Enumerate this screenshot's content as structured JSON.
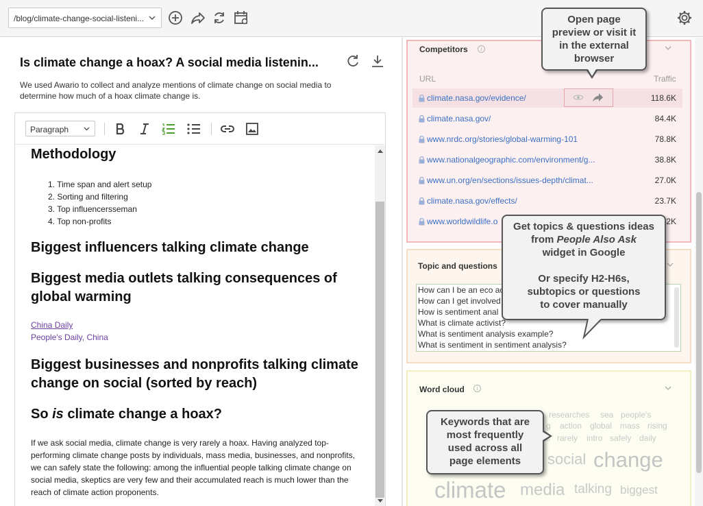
{
  "topbar": {
    "url_value": "/blog/climate-change-social-listeni...",
    "icons": [
      "add-icon",
      "share-icon",
      "refresh-icon",
      "calendar-icon",
      "gear-icon"
    ]
  },
  "page": {
    "title": "Is climate change a hoax? A social media listenin...",
    "description": "We used Awario to collect and analyze mentions of climate change on social media to determine how much of a hoax climate change is."
  },
  "editor": {
    "format_select": "Paragraph",
    "content": {
      "h_methodology": "Methodology",
      "list": [
        "Time span and alert setup",
        "Sorting and filtering",
        "Top influencerss",
        "eman",
        "Top non-profits"
      ],
      "h_influencers": "Biggest influencers talking climate change",
      "h_media_1": "Biggest media outlets talking consequences of",
      "h_media_2": "global warming",
      "link_china_daily": "China Daily",
      "link_peoples_daily": "People's Daily, China",
      "h_business_1": "Biggest businesses and nonprofits talking climate",
      "h_business_2": "change on social (sorted by reach)",
      "h_so_pre": "So ",
      "h_so_em": "is",
      "h_so_post": " climate change a hoax?",
      "paragraph": "If we ask social media, climate change is very rarely a hoax. Having analyzed top-performing climate change posts by individuals, mass media, businesses, and nonprofits, we can safely state the following: among the influential people talking climate change on social media, skeptics are very few and their accumulated reach is much lower than the reach of climate action proponents."
    }
  },
  "competitors": {
    "title": "Competitors",
    "col_url": "URL",
    "col_traffic": "Traffic",
    "rows": [
      {
        "url": "climate.nasa.gov/evidence/",
        "traffic": "118.6K"
      },
      {
        "url": "climate.nasa.gov/",
        "traffic": "84.4K"
      },
      {
        "url": "www.nrdc.org/stories/global-warming-101",
        "traffic": "78.8K"
      },
      {
        "url": "www.nationalgeographic.com/environment/g...",
        "traffic": "38.8K"
      },
      {
        "url": "www.un.org/en/sections/issues-depth/climat...",
        "traffic": "27.0K"
      },
      {
        "url": "climate.nasa.gov/effects/",
        "traffic": "23.7K"
      },
      {
        "url": "www.worldwildlife.o",
        "traffic": "2K"
      }
    ]
  },
  "topics": {
    "title": "Topic and questions",
    "questions": [
      "How can I be an eco ac",
      "How can I get involved",
      "How is sentiment anal",
      "What is climate activist?",
      "What is sentiment analysis example?",
      "What is sentiment in sentiment analysis?"
    ]
  },
  "wordcloud": {
    "title": "Word cloud",
    "words": {
      "researches": "researches",
      "sea": "sea",
      "peoples": "people's",
      "g": "g",
      "action": "action",
      "global": "global",
      "mass": "mass",
      "rising": "rising",
      "s": "s",
      "rarely": "rarely",
      "intro": "intro",
      "safely": "safely",
      "daily": "daily",
      "social": "social",
      "change": "change",
      "climate": "climate",
      "media": "media",
      "talking": "talking",
      "biggest": "biggest"
    }
  },
  "callouts": {
    "preview": [
      "Open page",
      "preview or visit it",
      "in the external",
      "browser"
    ],
    "topics_1": [
      "Get topics & questions ideas"
    ],
    "topics_2_pre": "from ",
    "topics_2_em": "People Also Ask",
    "topics_3": [
      "widget in Google"
    ],
    "topics_4": [
      "Or specify H2-H6s,",
      "subtopics or questions",
      "to cover manually"
    ],
    "keywords": [
      "Keywords that are",
      "most frequently",
      "used across all",
      "page elements"
    ]
  }
}
